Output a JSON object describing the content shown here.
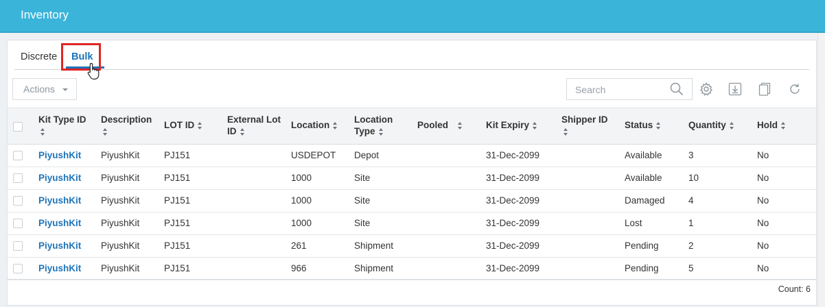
{
  "header": {
    "title": "Inventory"
  },
  "tabs": [
    {
      "label": "Discrete"
    },
    {
      "label": "Bulk",
      "active": true
    }
  ],
  "toolbar": {
    "actions_label": "Actions",
    "search_placeholder": "Search",
    "icons": [
      "gear-icon",
      "download-icon",
      "copy-icon",
      "refresh-icon"
    ]
  },
  "table": {
    "columns": [
      {
        "line1": "Kit Type ID",
        "line2": ""
      },
      {
        "line1": "Description",
        "line2": ""
      },
      {
        "line1": "LOT ID",
        "line2": ""
      },
      {
        "line1": "External Lot",
        "line2": "ID"
      },
      {
        "line1": "Location",
        "line2": ""
      },
      {
        "line1": "Location",
        "line2": "Type"
      },
      {
        "line1": "Pooled",
        "line2": ""
      },
      {
        "line1": "Kit Expiry",
        "line2": ""
      },
      {
        "line1": "Shipper ID",
        "line2": ""
      },
      {
        "line1": "Status",
        "line2": ""
      },
      {
        "line1": "Quantity",
        "line2": ""
      },
      {
        "line1": "Hold",
        "line2": ""
      }
    ],
    "rows": [
      [
        "PiyushKit",
        "PiyushKit",
        "PJ151",
        "",
        "USDEPOT",
        "Depot",
        "",
        "31-Dec-2099",
        "",
        "Available",
        "3",
        "No"
      ],
      [
        "PiyushKit",
        "PiyushKit",
        "PJ151",
        "",
        "1000",
        "Site",
        "",
        "31-Dec-2099",
        "",
        "Available",
        "10",
        "No"
      ],
      [
        "PiyushKit",
        "PiyushKit",
        "PJ151",
        "",
        "1000",
        "Site",
        "",
        "31-Dec-2099",
        "",
        "Damaged",
        "4",
        "No"
      ],
      [
        "PiyushKit",
        "PiyushKit",
        "PJ151",
        "",
        "1000",
        "Site",
        "",
        "31-Dec-2099",
        "",
        "Lost",
        "1",
        "No"
      ],
      [
        "PiyushKit",
        "PiyushKit",
        "PJ151",
        "",
        "261",
        "Shipment",
        "",
        "31-Dec-2099",
        "",
        "Pending",
        "2",
        "No"
      ],
      [
        "PiyushKit",
        "PiyushKit",
        "PJ151",
        "",
        "966",
        "Shipment",
        "",
        "31-Dec-2099",
        "",
        "Pending",
        "5",
        "No"
      ]
    ],
    "count_label": "Count: 6"
  },
  "colors": {
    "header_bg": "#3bb4da",
    "link": "#1e74b8",
    "highlight": "#e02424"
  }
}
